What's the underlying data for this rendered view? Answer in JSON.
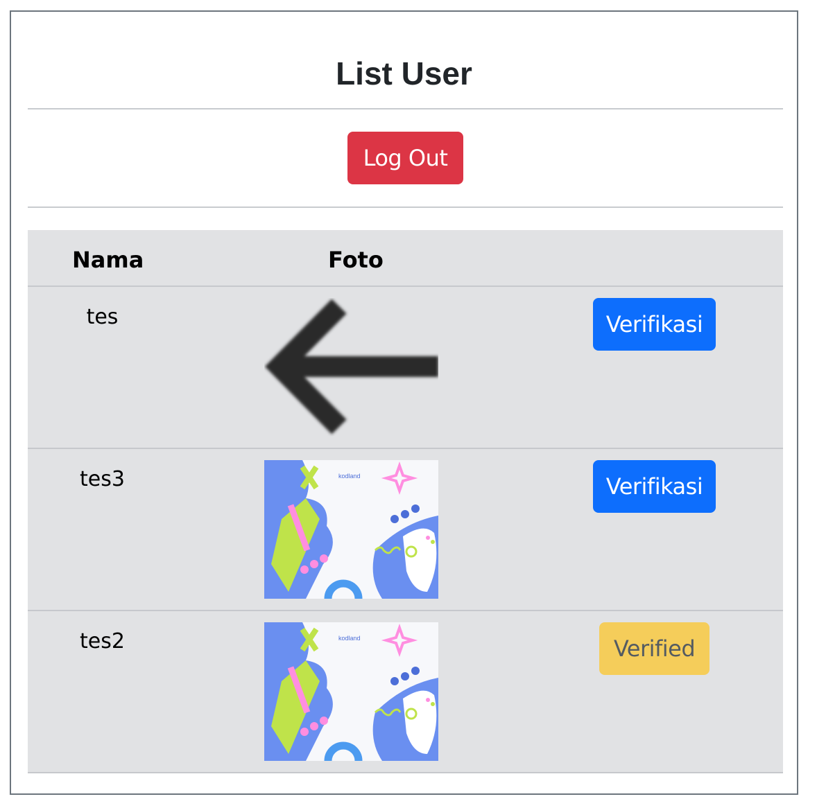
{
  "page": {
    "title": "List User",
    "logout_label": "Log Out"
  },
  "table": {
    "headers": [
      "Nama",
      "Foto",
      ""
    ],
    "rows": [
      {
        "nama": "tes",
        "foto": "arrow-left-image",
        "action": "Verifikasi",
        "action_type": "verify"
      },
      {
        "nama": "tes3",
        "foto": "kodland-banner-image",
        "photo_caption": "kodland",
        "action": "Verifikasi",
        "action_type": "verify"
      },
      {
        "nama": "tes2",
        "foto": "kodland-banner-image",
        "photo_caption": "kodland",
        "action": "Verified",
        "action_type": "verified"
      }
    ]
  },
  "colors": {
    "logout": "#dc3545",
    "verify": "#0d6efd",
    "verified": "#f5cd5a",
    "table_bg": "#e1e2e4"
  }
}
